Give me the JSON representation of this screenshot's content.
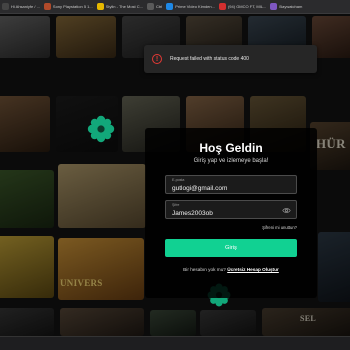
{
  "bookmarks": [
    {
      "label": "Hi Ahsaniyfe / ..."
    },
    {
      "label": "Sony Playstation 5 1..."
    },
    {
      "label": "Stylin - The Most C..."
    },
    {
      "label": "Ctrl"
    },
    {
      "label": "Prime Video Kimden..."
    },
    {
      "label": "(94) GMCO FT, MIL..."
    },
    {
      "label": "Baywatcham"
    }
  ],
  "wall": {
    "posters": [
      {
        "text": "HÜR"
      },
      {
        "text": "UNIVERS"
      },
      {
        "text": "SEL"
      }
    ]
  },
  "toast": {
    "icon": "exclamation-circle-icon",
    "message": "Request failed with status code 400",
    "color": "#e53935"
  },
  "login": {
    "title": "Hoş Geldin",
    "subtitle": "Giriş yap ve izlemeye başla!",
    "email_label": "E-posta",
    "email_value": "gutlogi@gmail.com",
    "password_label": "Şifre",
    "password_value": "James2003ob",
    "forgot": "Şifreni mi unuttun?",
    "submit": "Giriş",
    "no_account": "Bir hesabın yok mu?",
    "signup_link": "Ücretsiz Hesap Oluştur",
    "accent_color": "#11d192"
  }
}
